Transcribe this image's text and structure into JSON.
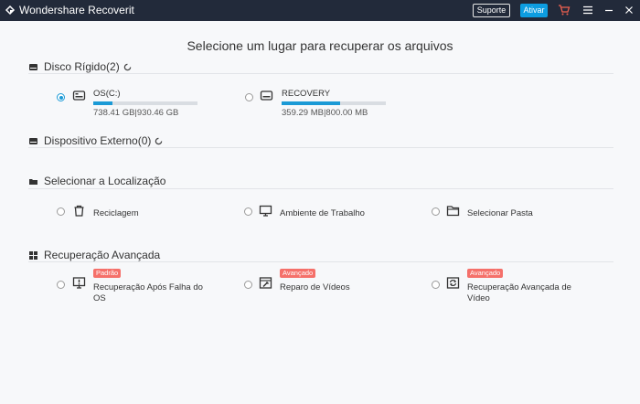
{
  "titlebar": {
    "app_title": "Wondershare Recoverit",
    "support_label": "Suporte",
    "activate_label": "Ativar",
    "icons": [
      "cart-icon",
      "menu-icon",
      "minimize-icon",
      "close-icon"
    ]
  },
  "heading": "Selecione um lugar para recuperar os arquivos",
  "hard_disk": {
    "title": "Disco Rígido(2)",
    "drives": [
      {
        "name": "OS(C:)",
        "size": "738.41 GB|930.46 GB",
        "used_fraction": 0.18,
        "selected": true
      },
      {
        "name": "RECOVERY",
        "size": "359.29 MB|800.00 MB",
        "used_fraction": 0.56,
        "selected": false
      }
    ]
  },
  "external": {
    "title": "Dispositivo Externo(0)"
  },
  "location": {
    "title": "Selecionar a Localização",
    "items": [
      {
        "label": "Reciclagem",
        "icon": "trash-icon"
      },
      {
        "label": "Ambiente de Trabalho",
        "icon": "desktop-icon"
      },
      {
        "label": "Selecionar Pasta",
        "icon": "folder-icon"
      }
    ]
  },
  "advanced": {
    "title": "Recuperação Avançada",
    "items": [
      {
        "badge": "Padrão",
        "label_line1": "Recuperação Após Falha do",
        "label_line2": "OS"
      },
      {
        "badge": "Avançado",
        "label_line1": "Reparo de Vídeos",
        "label_line2": ""
      },
      {
        "badge": "Avançado",
        "label_line1": "Recuperação Avançada de",
        "label_line2": "Vídeo"
      }
    ]
  },
  "colors": {
    "titlebar": "#222a3a",
    "accent": "#1b9ad6",
    "badge": "#f5706a"
  }
}
